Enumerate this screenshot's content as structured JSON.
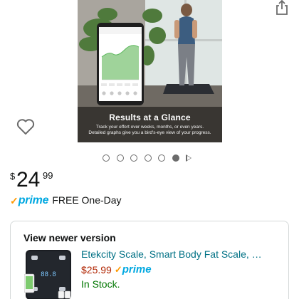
{
  "hero": {
    "title": "Results at a Glance",
    "subtitle_line1": "Track your effort over weeks, months, or even years.",
    "subtitle_line2": "Detailed graphs give you a bird's-eye view of your progress."
  },
  "carousel": {
    "total_dots": 6,
    "active_index": 5,
    "has_video": true
  },
  "price": {
    "symbol": "$",
    "whole": "24",
    "fraction": "99"
  },
  "delivery": {
    "prime_label": "prime",
    "text": "FREE One-Day"
  },
  "newer_version": {
    "heading": "View newer version",
    "product_title": "Etekcity Scale, Smart Body Fat Scale, …",
    "price": "$25.99",
    "prime_label": "prime",
    "availability": "In Stock."
  },
  "icons": {
    "share": "share-icon",
    "wishlist": "heart-icon",
    "prime_check": "prime-check-icon"
  },
  "colors": {
    "link": "#007185",
    "price_red": "#b12704",
    "stock_green": "#007600",
    "prime_blue": "#00a8e1",
    "prime_orange": "#ff9900"
  }
}
